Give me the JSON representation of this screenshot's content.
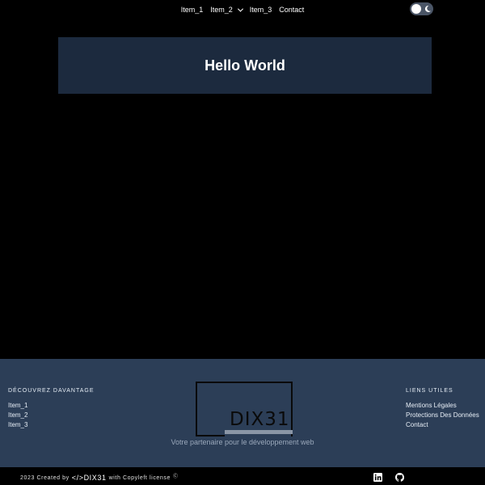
{
  "nav": {
    "items": [
      {
        "label": "Item_1",
        "dropdown": false
      },
      {
        "label": "Item_2",
        "dropdown": true
      },
      {
        "label": "Item_3",
        "dropdown": false
      },
      {
        "label": "Contact",
        "dropdown": false
      }
    ],
    "theme_toggle": {
      "state": "dark",
      "icon": "moon-icon"
    }
  },
  "hero": {
    "title": "Hello World"
  },
  "footer": {
    "left": {
      "heading": "DÉCOUVREZ DAVANTAGE",
      "links": [
        "Item_1",
        "Item_2",
        "Item_3"
      ]
    },
    "brand": {
      "name": "DIX31"
    },
    "tagline": "Votre partenaire pour le développement web",
    "right": {
      "heading": "LIENS UTILES",
      "links": [
        "Mentions Légales",
        "Protections Des Données",
        "Contact"
      ]
    }
  },
  "bottom": {
    "copy_prefix": "2023 Created by",
    "logo_text": "</>DIX31",
    "copy_suffix": "with Copyleft license",
    "copyleft_mark": "Ⓒ",
    "social_icons": [
      "linkedin-icon",
      "github-icon"
    ]
  },
  "colors": {
    "background": "#000000",
    "hero": "#1c2a3e",
    "footer": "#2c3e57",
    "toggle": "#4a5566"
  }
}
